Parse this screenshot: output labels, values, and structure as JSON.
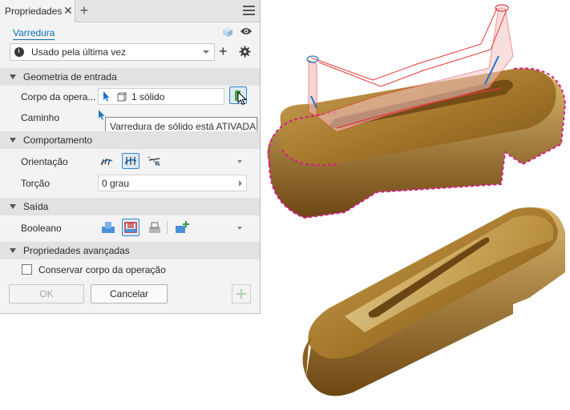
{
  "panel": {
    "tab_label": "Propriedades",
    "command_name": "Varredura",
    "preset": "Usado pela última vez"
  },
  "sections": {
    "input_geometry": "Geometria de entrada",
    "behavior": "Comportamento",
    "output": "Saída",
    "advanced": "Propriedades avançadas"
  },
  "input": {
    "profile_label": "Corpo da opera...",
    "profile_value": "1 sólido",
    "path_label": "Caminho"
  },
  "tooltip": "Varredura de sólido está ATIVADA",
  "behavior": {
    "orientation_label": "Orientação",
    "twist_label": "Torção",
    "twist_value": "0 grau"
  },
  "output": {
    "boolean_label": "Booleano"
  },
  "advanced": {
    "keep_body_label": "Conservar corpo da operação",
    "keep_body_checked": false
  },
  "buttons": {
    "ok": "OK",
    "cancel": "Cancelar"
  },
  "colors": {
    "accent": "#0a6fb5",
    "selection": "#2f88cf",
    "toggle_on": "#46a24a",
    "gold": "#a77a2c",
    "preview_line": "#e53935",
    "magenta_edge": "#d81b8a"
  }
}
